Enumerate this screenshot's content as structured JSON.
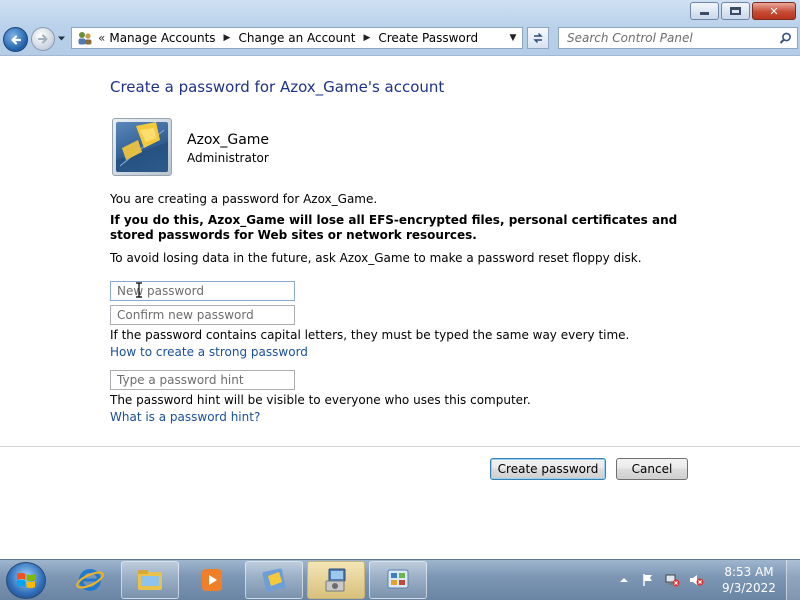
{
  "window": {
    "minimize_icon": "minimize-icon",
    "maximize_icon": "restore-icon",
    "close_icon": "close-icon"
  },
  "nav": {
    "back_icon": "back-arrow-icon",
    "forward_icon": "forward-arrow-icon",
    "recent_icon": "chevron-down-icon"
  },
  "address": {
    "overflow": "«",
    "crumbs": [
      "Manage Accounts",
      "Change an Account",
      "Create Password"
    ],
    "separator": "▶",
    "dropdown": "▼"
  },
  "search": {
    "placeholder": "Search Control Panel"
  },
  "page": {
    "title": "Create a password for Azox_Game's account",
    "user_name": "Azox_Game",
    "user_role": "Administrator",
    "intro": "You are creating a password for Azox_Game.",
    "warning": "If you do this, Azox_Game will lose all EFS-encrypted files, personal certificates and stored passwords for Web sites or network resources.",
    "advice": "To avoid losing data in the future, ask Azox_Game to make a password reset floppy disk.",
    "new_password_placeholder": "New password",
    "confirm_password_placeholder": "Confirm new password",
    "case_note": "If the password contains capital letters, they must be typed the same way every time.",
    "strong_password_link": "How to create a strong password",
    "hint_placeholder": "Type a password hint",
    "hint_note": "The password hint will be visible to everyone who uses this computer.",
    "hint_link": "What is a password hint?",
    "create_button": "Create password",
    "cancel_button": "Cancel"
  },
  "taskbar": {
    "items": [
      "internet-explorer",
      "windows-explorer",
      "media-player",
      "control-panel-users",
      "installer",
      "control-panel"
    ],
    "time": "8:53 AM",
    "date": "9/3/2022"
  },
  "colors": {
    "title_blue": "#1e3287",
    "link_blue": "#1a4f9c"
  }
}
